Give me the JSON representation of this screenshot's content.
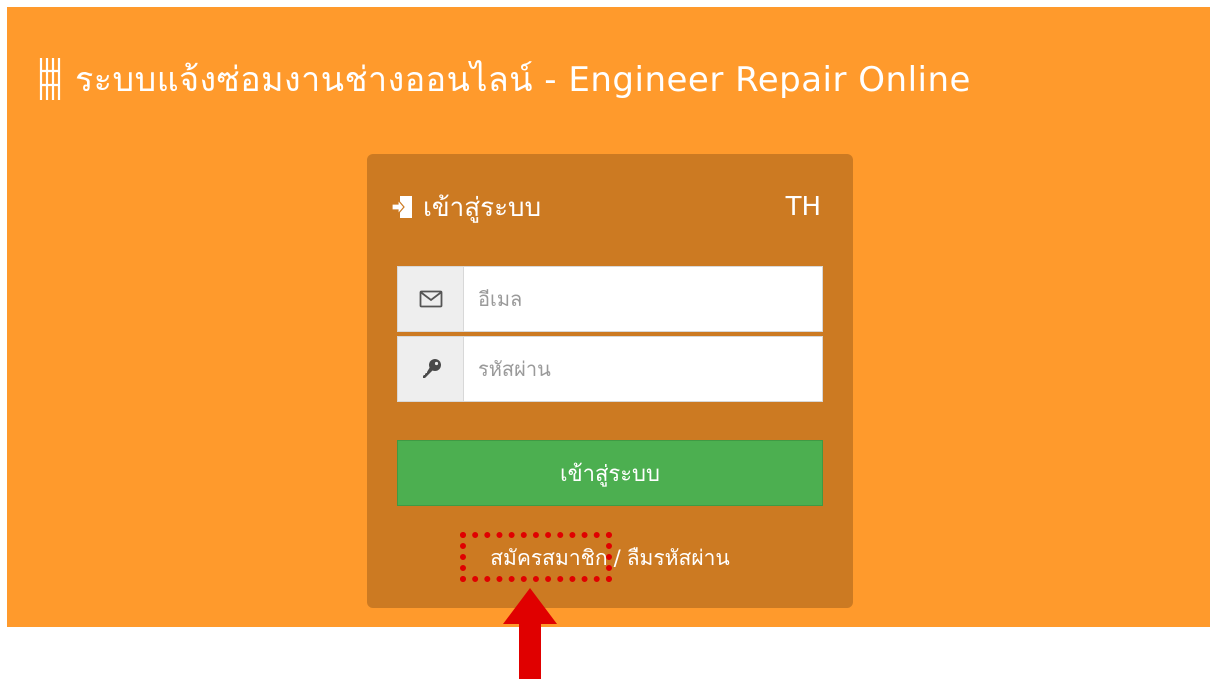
{
  "app": {
    "title": "ระบบแจ้งซ่อมงานช่างออนไลน์ - Engineer Repair Online",
    "logo_icon": "building-grid-icon"
  },
  "login": {
    "heading": "เข้าสู่ระบบ",
    "heading_icon": "sign-in-icon",
    "language": "TH",
    "email": {
      "icon": "envelope-icon",
      "placeholder": "อีเมล",
      "value": ""
    },
    "password": {
      "icon": "key-icon",
      "placeholder": "รหัสผ่าน",
      "value": ""
    },
    "submit_label": "เข้าสู่ระบบ",
    "register_link": "สมัครสมาชิก",
    "separator": "/",
    "forgot_link": "ลืมรหัสผ่าน"
  },
  "annotation": {
    "highlight_target": "register-link",
    "color": "#e00000"
  },
  "colors": {
    "background": "#ff9a2c",
    "panel": "#cc7a22",
    "button": "#4caf50"
  }
}
